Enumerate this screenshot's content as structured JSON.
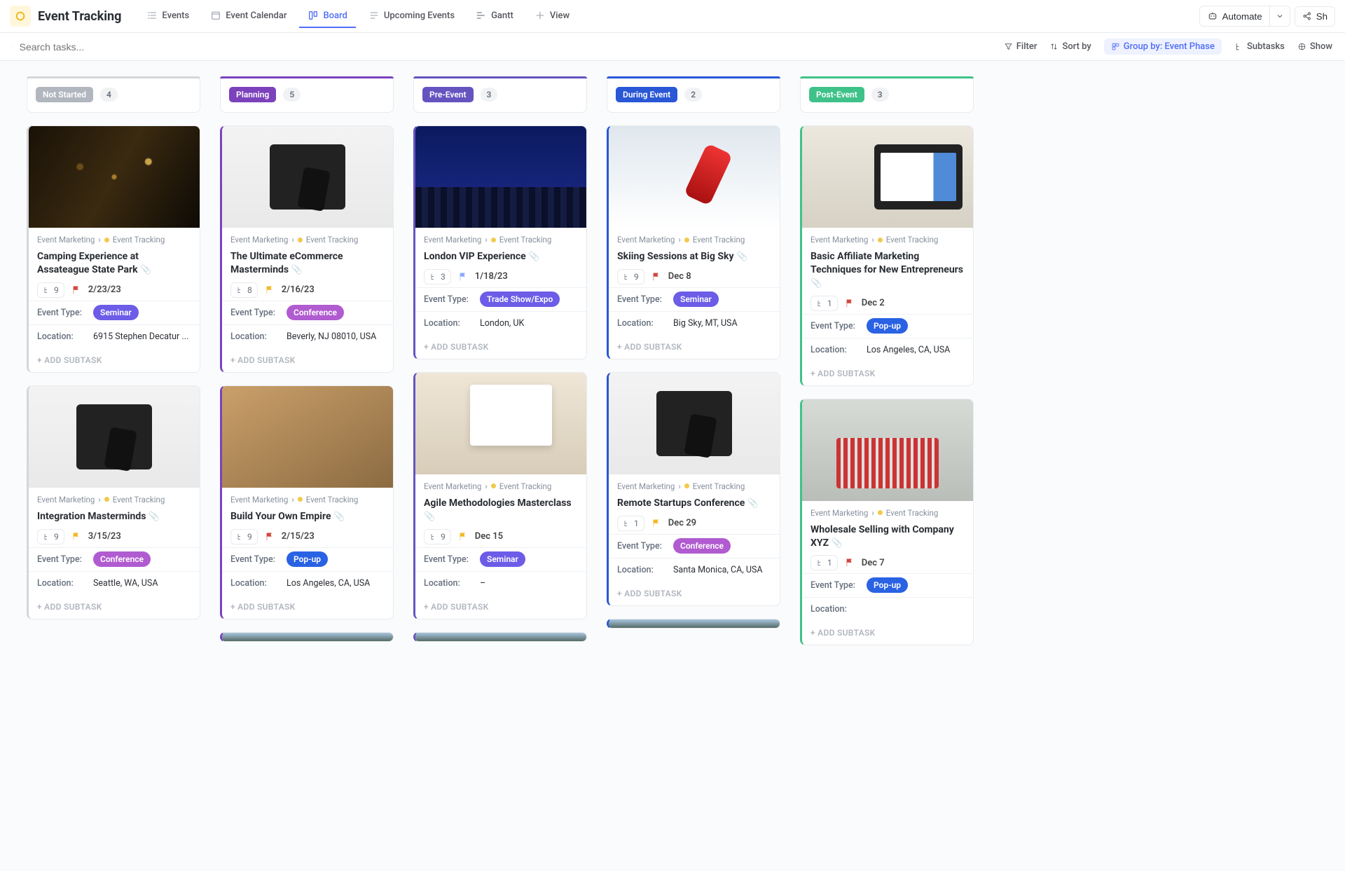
{
  "page_title": "Event Tracking",
  "crumbs": {
    "parent": "Event Marketing",
    "child": "Event Tracking"
  },
  "header_tabs": [
    {
      "label": "Events"
    },
    {
      "label": "Event Calendar"
    },
    {
      "label": "Board"
    },
    {
      "label": "Upcoming Events"
    },
    {
      "label": "Gantt"
    },
    {
      "label": "View"
    }
  ],
  "header_actions": {
    "automate": "Automate",
    "share": "Sh"
  },
  "toolbar": {
    "search_placeholder": "Search tasks...",
    "filter": "Filter",
    "sort": "Sort by",
    "group": "Group by: Event Phase",
    "subtasks": "Subtasks",
    "show": "Show"
  },
  "columns": [
    {
      "title": "Not Started",
      "count": "4",
      "accent": "#d5d6d8",
      "pill": "#b1b6bf"
    },
    {
      "title": "Planning",
      "count": "5",
      "accent": "#7b42bc",
      "pill": "#7b42bc"
    },
    {
      "title": "Pre-Event",
      "count": "3",
      "accent": "#6554c0",
      "pill": "#6554c0"
    },
    {
      "title": "During Event",
      "count": "2",
      "accent": "#2957d6",
      "pill": "#2957d6"
    },
    {
      "title": "Post-Event",
      "count": "3",
      "accent": "#3fc28a",
      "pill": "#3fc28a"
    }
  ],
  "labels": {
    "event_type": "Event Type:",
    "location": "Location:",
    "add_subtask": "+ ADD SUBTASK"
  },
  "tag_colors": {
    "Seminar": "#6c5ce7",
    "Conference": "#b05bd0",
    "Trade Show/Expo": "#6c5ce7",
    "Pop-up": "#2a62e4"
  },
  "flag_colors": {
    "red": "#d1453b",
    "yellow": "#f2b824",
    "blue": "#89a9ff"
  },
  "cards": {
    "ns": [
      {
        "title": "Camping Experience at Assateague State Park",
        "subtasks": "9",
        "date": "2/23/23",
        "flag": "red",
        "type": "Seminar",
        "loc": "6915 Stephen Decatur ...",
        "cover": "cov-lights"
      },
      {
        "title": "Integration Masterminds",
        "subtasks": "9",
        "date": "3/15/23",
        "flag": "yellow",
        "type": "Conference",
        "loc": "Seattle, WA, USA",
        "cover": "cov-laptop"
      }
    ],
    "pl": [
      {
        "title": "The Ultimate eCommerce Masterminds",
        "subtasks": "8",
        "date": "2/16/23",
        "flag": "yellow",
        "type": "Conference",
        "loc": "Beverly, NJ 08010, USA",
        "cover": "cov-laptop"
      },
      {
        "title": "Build Your Own Empire",
        "subtasks": "9",
        "date": "2/15/23",
        "flag": "red",
        "type": "Pop-up",
        "loc": "Los Angeles, CA, USA",
        "cover": "cov-meet"
      }
    ],
    "pr": [
      {
        "title": "London VIP Experience",
        "subtasks": "3",
        "date": "1/18/23",
        "flag": "blue",
        "type": "Trade Show/Expo",
        "loc": "London, UK",
        "cover": "cov-aud"
      },
      {
        "title": "Agile Methodologies Masterclass",
        "subtasks": "9",
        "date": "Dec 15",
        "flag": "yellow",
        "type": "Seminar",
        "loc": "–",
        "cover": "cov-infog"
      }
    ],
    "du": [
      {
        "title": "Skiing Sessions at Big Sky",
        "subtasks": "9",
        "date": "Dec 8",
        "flag": "red",
        "type": "Seminar",
        "loc": "Big Sky, MT, USA",
        "cover": "cov-ski"
      },
      {
        "title": "Remote Startups Conference",
        "subtasks": "1",
        "date": "Dec 29",
        "flag": "yellow",
        "type": "Conference",
        "loc": "Santa Monica, CA, USA",
        "cover": "cov-laptop"
      }
    ],
    "po": [
      {
        "title": "Basic Affiliate Marketing Techniques for New Entrepreneurs",
        "subtasks": "1",
        "date": "Dec 2",
        "flag": "red",
        "type": "Pop-up",
        "loc": "Los Angeles, CA, USA",
        "cover": "cov-desk"
      },
      {
        "title": "Wholesale Selling with Company XYZ",
        "subtasks": "1",
        "date": "Dec 7",
        "flag": "red",
        "type": "Pop-up",
        "loc": "",
        "cover": "cov-carts"
      }
    ]
  }
}
